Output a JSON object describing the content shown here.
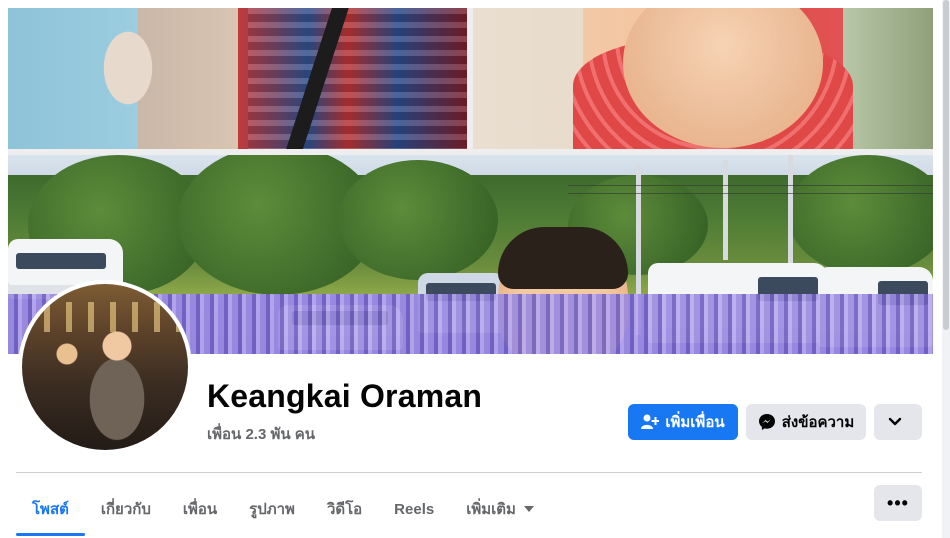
{
  "profile": {
    "name": "Keangkai Oraman",
    "friends_count": "เพื่อน 2.3 พัน คน"
  },
  "actions": {
    "add_friend_label": "เพิ่มเพื่อน",
    "message_label": "ส่งข้อความ",
    "more_icon": "chevron-down-icon",
    "options_label": "•••"
  },
  "tabs": [
    {
      "label": "โพสต์",
      "active": true
    },
    {
      "label": "เกี่ยวกับ",
      "active": false
    },
    {
      "label": "เพื่อน",
      "active": false
    },
    {
      "label": "รูปภาพ",
      "active": false
    },
    {
      "label": "วิดีโอ",
      "active": false
    },
    {
      "label": "Reels",
      "active": false
    },
    {
      "label": "เพิ่มเติม",
      "active": false,
      "dropdown": true
    }
  ],
  "colors": {
    "accent": "#1877f2",
    "secondary_button": "#e4e6eb",
    "muted_text": "#65676b",
    "text": "#050505"
  }
}
